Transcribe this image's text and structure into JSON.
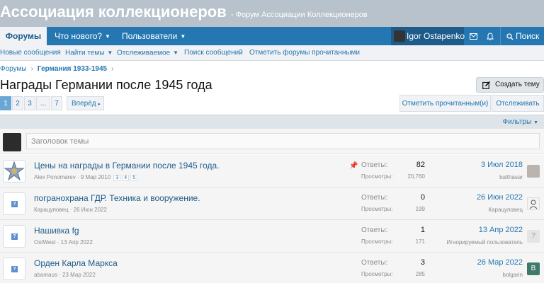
{
  "header": {
    "site_title": "Ассоциация коллекционеров",
    "site_subtitle": "- Форум Ассоциации Коллекционеров"
  },
  "nav": {
    "forums": "Форумы",
    "whats_new": "Что нового?",
    "users": "Пользователи",
    "username": "Igor Ostapenko",
    "search": "Поиск"
  },
  "subnav": {
    "items": [
      "Новые сообщения",
      "Найти темы",
      "Отслеживаемое",
      "Поиск сообщений",
      "Отметить форумы прочитанными"
    ]
  },
  "breadcrumb": {
    "root": "Форумы",
    "parent": "Германия 1933-1945"
  },
  "page": {
    "title": "Награды Германии после 1945 года",
    "create_thread": "Создать тему"
  },
  "pagination": {
    "pages": [
      "1",
      "2",
      "3",
      "...",
      "7"
    ],
    "current": "1",
    "next": "Вперёд"
  },
  "actions": {
    "mark_read": "Отметить прочитанным(и)",
    "watch": "Отслеживать",
    "filters": "Фильтры"
  },
  "new_thread": {
    "placeholder": "Заголовок темы"
  },
  "labels": {
    "replies": "Ответы:",
    "views": "Просмотры:"
  },
  "threads": [
    {
      "title": "Цены на награды в Германии после 1945 года.",
      "author": "Alex Ponomarev",
      "date": "9 Мар 2010",
      "pages": [
        "3",
        "4",
        "5"
      ],
      "pinned": true,
      "replies": "82",
      "views": "20,760",
      "last_date": "3 Июл 2018",
      "last_user": "balthasar"
    },
    {
      "title": "погранохрана ГДР. Техника и вооружение.",
      "author": "Карацуповец",
      "date": "26 Июн 2022",
      "replies": "0",
      "views": "199",
      "last_date": "26 Июн 2022",
      "last_user": "Карацуповец"
    },
    {
      "title": "Нашивка fg",
      "author": "OstWest",
      "date": "13 Апр 2022",
      "replies": "1",
      "views": "171",
      "last_date": "13 Апр 2022",
      "last_user": "Игнорируемый пользователь",
      "last_avatar_letter": "?"
    },
    {
      "title": "Орден Карла Маркса",
      "author": "abamaus",
      "date": "23 Мар 2022",
      "replies": "3",
      "views": "285",
      "last_date": "26 Мар 2022",
      "last_user": "bolgarin",
      "last_avatar_letter": "B"
    }
  ],
  "colors": {
    "header_bg": "#b8c2cc",
    "nav_bg": "#2577b1",
    "link": "#2577b1",
    "row_bg": "#f5f5f5",
    "bolgarin_avatar": "#3e7a6b"
  }
}
